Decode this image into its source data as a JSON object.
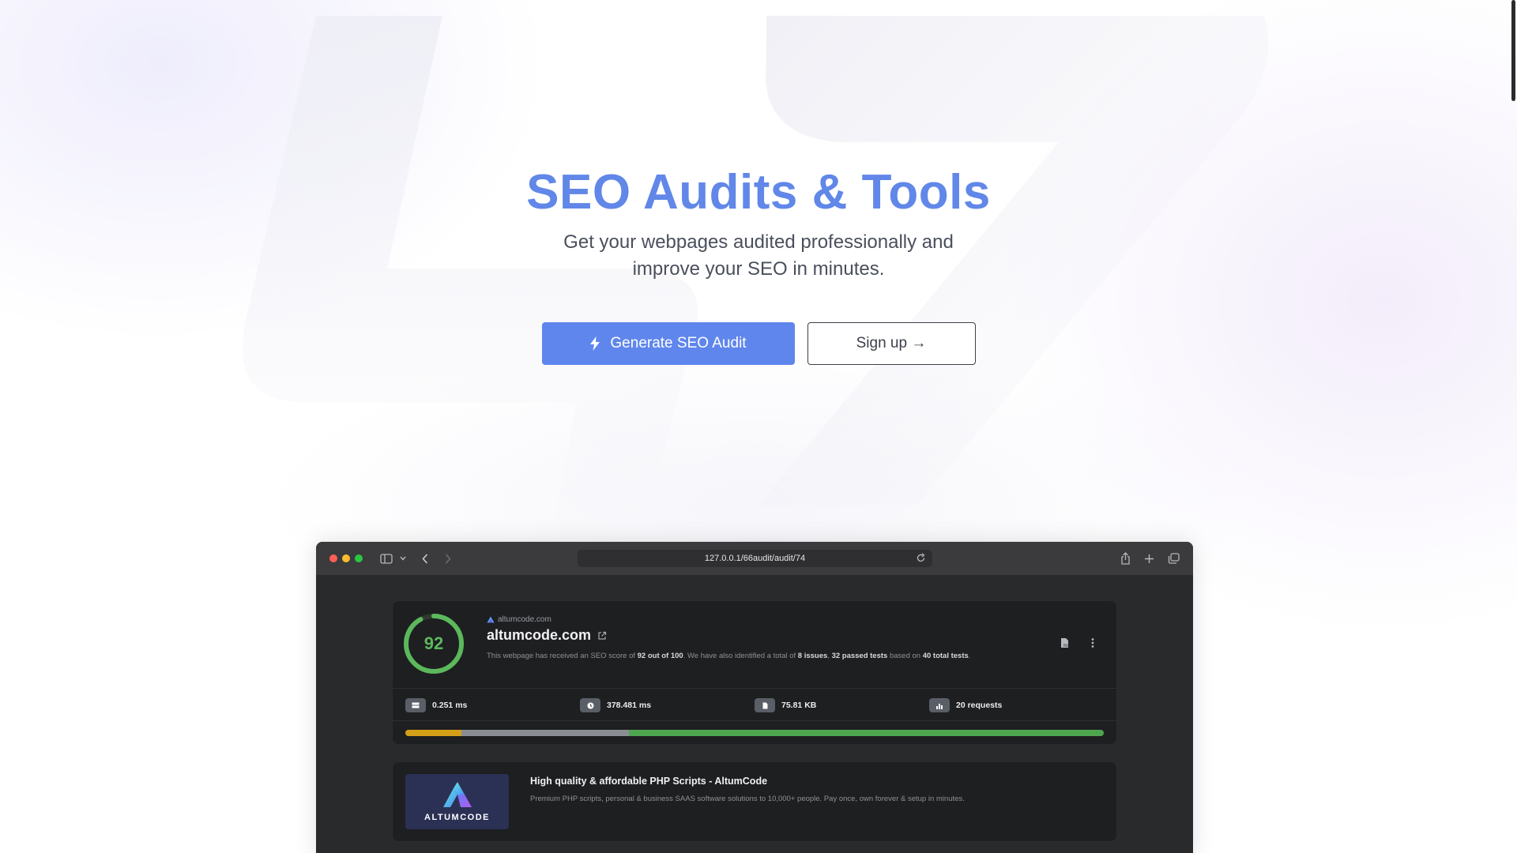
{
  "hero": {
    "title": "SEO Audits & Tools",
    "subtitle": "Get your webpages audited professionally and improve your SEO in minutes.",
    "primary_button": "Generate SEO Audit",
    "secondary_button": "Sign up →"
  },
  "colors": {
    "accent": "#5f86ec",
    "title": "#6187e8",
    "score_green": "#5cb85c",
    "bar_warning": "#d4a017",
    "bar_neutral": "#8a8d94",
    "bar_success": "#4ea64e"
  },
  "browser": {
    "url": "127.0.0.1/66audit/audit/74",
    "toolbar_icons": [
      "sidebar-icon",
      "chevron-down-icon",
      "back-icon",
      "forward-icon",
      "reload-icon",
      "share-icon",
      "new-tab-icon",
      "tabs-icon"
    ]
  },
  "audit": {
    "score": "92",
    "score_value": 92,
    "domain_small": "altumcode.com",
    "domain_title": "altumcode.com",
    "description_prefix": "This webpage has received an SEO score of ",
    "score_text": "92 out of 100",
    "description_mid1": ". We have also identified a total of ",
    "issues_text": "8 issues",
    "description_mid2": ", ",
    "passed_text": "32 passed tests",
    "description_mid3": " based on ",
    "total_text": "40 total tests",
    "description_suffix": ".",
    "stats": [
      {
        "icon": "server-icon",
        "value": "0.251 ms"
      },
      {
        "icon": "clock-icon",
        "value": "378.481 ms"
      },
      {
        "icon": "file-icon",
        "value": "75.81 KB"
      },
      {
        "icon": "chart-icon",
        "value": "20 requests"
      }
    ],
    "progress": {
      "warning": 8,
      "neutral": 24,
      "success": 68
    }
  },
  "ad": {
    "logo_text": "ALTUMCODE",
    "title": "High quality & affordable PHP Scripts - AltumCode",
    "description": "Premium PHP scripts, personal & business SAAS software solutions to 10,000+ people. Pay once, own forever & setup in minutes."
  }
}
